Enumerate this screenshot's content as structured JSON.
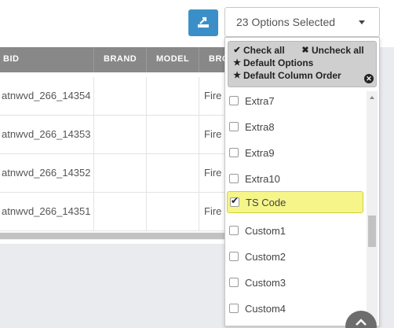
{
  "header": {
    "export_icon": "export-arrow-icon",
    "options_select_label": "23 Options Selected"
  },
  "grid": {
    "columns": [
      "BID",
      "BRAND",
      "MODEL",
      "BRO"
    ],
    "rows": [
      {
        "bid": "atnwvd_266_14354",
        "brand": "",
        "model": "",
        "browser": "Fire"
      },
      {
        "bid": "atnwvd_266_14353",
        "brand": "",
        "model": "",
        "browser": "Fire"
      },
      {
        "bid": "atnwvd_266_14352",
        "brand": "",
        "model": "",
        "browser": "Fire"
      },
      {
        "bid": "atnwvd_266_14351",
        "brand": "",
        "model": "",
        "browser": "Fire"
      }
    ]
  },
  "dropdown": {
    "check_all": "Check all",
    "uncheck_all": "Uncheck all",
    "default_options": "Default Options",
    "default_column_order": "Default Column Order",
    "items": [
      {
        "label": "Extra7",
        "checked": false
      },
      {
        "label": "Extra8",
        "checked": false
      },
      {
        "label": "Extra9",
        "checked": false
      },
      {
        "label": "Extra10",
        "checked": false
      },
      {
        "label": "TS Code",
        "checked": true
      },
      {
        "label": "Custom1",
        "checked": false
      },
      {
        "label": "Custom2",
        "checked": false
      },
      {
        "label": "Custom3",
        "checked": false
      },
      {
        "label": "Custom4",
        "checked": false
      }
    ]
  },
  "colors": {
    "accent": "#3b8fc9",
    "header_gray": "#888888",
    "highlight": "#f5f58a"
  }
}
